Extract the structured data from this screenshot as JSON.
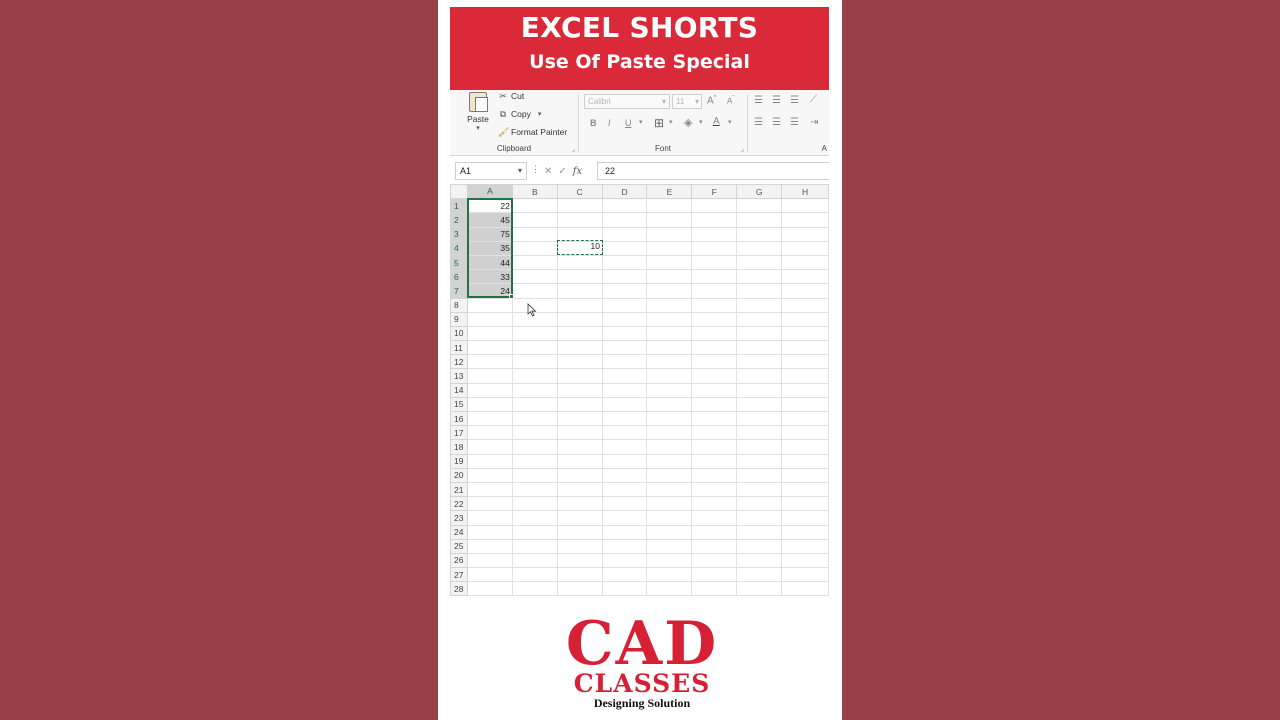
{
  "banner": {
    "title": "EXCEL SHORTS",
    "subtitle": "Use Of Paste Special"
  },
  "ribbon": {
    "clipboard": {
      "paste_label": "Paste",
      "cut_label": "Cut",
      "copy_label": "Copy",
      "format_painter_label": "Format Painter",
      "group_label": "Clipboard"
    },
    "font": {
      "font_name": "Calibri",
      "font_size": "11",
      "bold": "B",
      "italic": "I",
      "underline": "U",
      "font_color_letter": "A",
      "group_label": "Font"
    },
    "alignment": {
      "group_label": "A"
    }
  },
  "formula_bar": {
    "name_box": "A1",
    "fx": "fx",
    "value": "22"
  },
  "sheet": {
    "columns": [
      "A",
      "B",
      "C",
      "D",
      "E",
      "F",
      "G",
      "H"
    ],
    "rows": [
      "1",
      "2",
      "3",
      "4",
      "5",
      "6",
      "7",
      "8",
      "9",
      "10",
      "11",
      "12",
      "13",
      "14",
      "15",
      "16",
      "17",
      "18",
      "19",
      "20",
      "21",
      "22",
      "23",
      "24",
      "25",
      "26",
      "27",
      "28"
    ],
    "column_a_values": [
      "22",
      "45",
      "75",
      "35",
      "44",
      "33",
      "24"
    ],
    "copied_cell": {
      "ref": "C4",
      "value": "10"
    }
  },
  "logo": {
    "main": "CAD",
    "sub": "CLASSES",
    "tagline": "Designing Solution"
  },
  "colors": {
    "background": "#974049",
    "banner": "#da2a3a",
    "excel_green": "#217346",
    "logo_red": "#d62035"
  }
}
